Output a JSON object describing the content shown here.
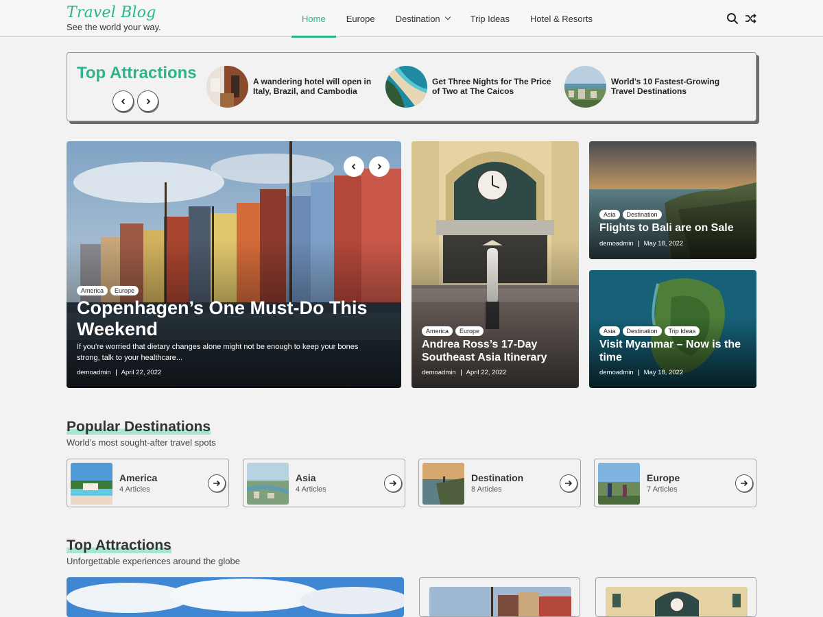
{
  "header": {
    "logo_title": "Travel Blog",
    "logo_tagline": "See the world your way.",
    "nav": [
      {
        "label": "Home",
        "active": true
      },
      {
        "label": "Europe"
      },
      {
        "label": "Destination",
        "has_dropdown": true
      },
      {
        "label": "Trip Ideas"
      },
      {
        "label": "Hotel & Resorts"
      }
    ],
    "icons": [
      "search-icon",
      "shuffle-icon"
    ]
  },
  "ticker": {
    "title": "Top Attractions",
    "items": [
      {
        "title": "A wandering hotel will open in Italy, Brazil, and Cambodia"
      },
      {
        "title": "Get Three Nights for The Price of Two at The Caicos"
      },
      {
        "title": "World’s 10 Fastest-Growing Travel Destinations"
      }
    ]
  },
  "hero": {
    "main": {
      "tags": [
        "America",
        "Europe"
      ],
      "title": "Copenhagen’s One Must-Do This Weekend",
      "excerpt": "If you’re worried that dietary changes alone might not be enough to keep your bones strong, talk to your healthcare...",
      "author": "demoadmin",
      "date": "April 22, 2022"
    },
    "middle": {
      "tags": [
        "America",
        "Europe"
      ],
      "title": "Andrea Ross’s 17-Day Southeast Asia Itinerary",
      "author": "demoadmin",
      "date": "April 22, 2022"
    },
    "right_top": {
      "tags": [
        "Asia",
        "Destination"
      ],
      "title": "Flights to Bali are on Sale",
      "author": "demoadmin",
      "date": "May 18, 2022"
    },
    "right_bottom": {
      "tags": [
        "Asia",
        "Destination",
        "Trip Ideas"
      ],
      "title": "Visit Myanmar – Now is the time",
      "author": "demoadmin",
      "date": "May 18, 2022"
    }
  },
  "popular": {
    "title": "Popular Destinations",
    "subtitle": "World’s most sought-after travel spots",
    "categories": [
      {
        "name": "America",
        "count": "4 Articles"
      },
      {
        "name": "Asia",
        "count": "4 Articles"
      },
      {
        "name": "Destination",
        "count": "8 Articles"
      },
      {
        "name": "Europe",
        "count": "7 Articles"
      }
    ]
  },
  "attractions": {
    "title": "Top Attractions",
    "subtitle": "Unforgettable experiences around the globe"
  },
  "colors": {
    "accent": "#2bb58c",
    "highlight": "#a7e4d2",
    "background": "#f2f2f2"
  }
}
